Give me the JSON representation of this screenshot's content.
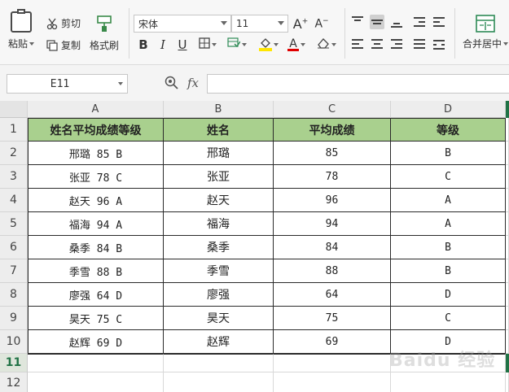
{
  "ribbon": {
    "paste_label": "粘贴",
    "cut_label": "剪切",
    "copy_label": "复制",
    "format_painter_label": "格式刷",
    "font_name": "宋体",
    "font_size": "11",
    "merge_center_label": "合并居中",
    "font_color": "#e00000",
    "fill_color": "#ffe600"
  },
  "formula_bar": {
    "cell_ref": "E11",
    "fx": "fx",
    "content": ""
  },
  "sheet": {
    "columns": [
      "A",
      "B",
      "C",
      "D"
    ],
    "rows": [
      "1",
      "2",
      "3",
      "4",
      "5",
      "6",
      "7",
      "8",
      "9",
      "10",
      "11",
      "12"
    ],
    "header_row": [
      "姓名平均成绩等级",
      "姓名",
      "平均成绩",
      "等级"
    ],
    "data": [
      [
        "邢璐 85 B",
        "邢璐",
        "85",
        "B"
      ],
      [
        "张亚 78 C",
        "张亚",
        "78",
        "C"
      ],
      [
        "赵天 96 A",
        "赵天",
        "96",
        "A"
      ],
      [
        "福海 94 A",
        "福海",
        "94",
        "A"
      ],
      [
        "桑季 84 B",
        "桑季",
        "84",
        "B"
      ],
      [
        "季雪 88 B",
        "季雪",
        "88",
        "B"
      ],
      [
        "廖强 64 D",
        "廖强",
        "64",
        "D"
      ],
      [
        "昊天 75 C",
        "昊天",
        "75",
        "C"
      ],
      [
        "赵辉 69 D",
        "赵辉",
        "69",
        "D"
      ]
    ],
    "header_fill": "#a9d08e",
    "selection_color": "#217346"
  },
  "watermark": "Baidu 经验"
}
